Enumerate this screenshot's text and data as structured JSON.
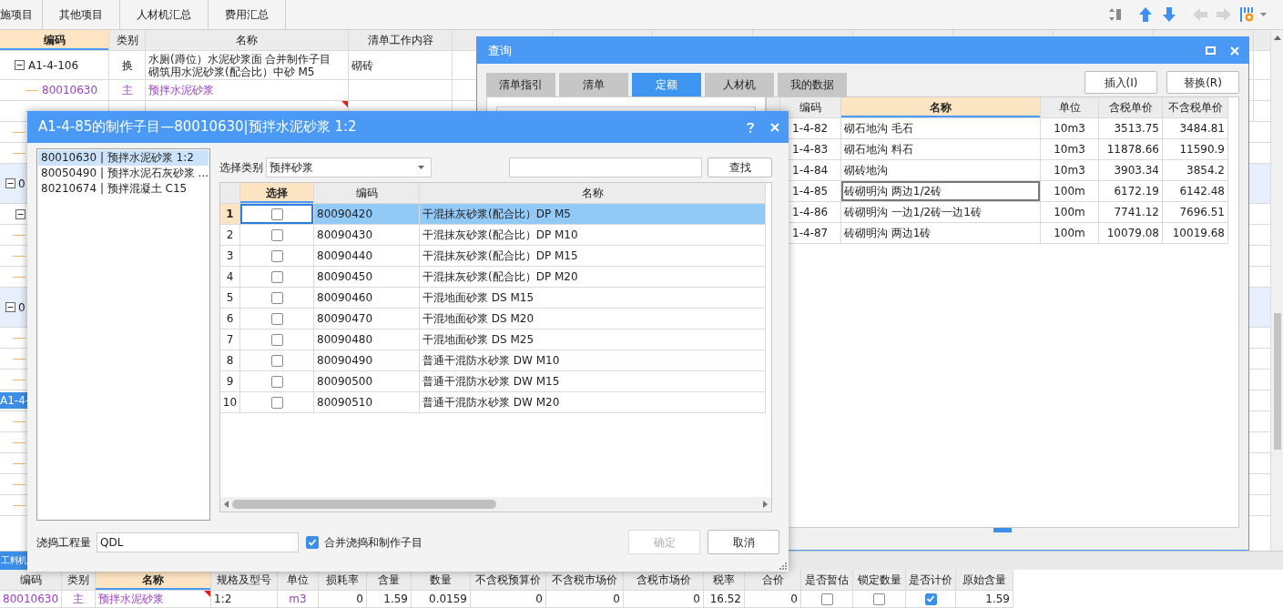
{
  "app_tabs": [
    {
      "label": "施项目"
    },
    {
      "label": "其他项目"
    },
    {
      "label": "人材机汇总"
    },
    {
      "label": "费用汇总"
    }
  ],
  "toolbar": [
    {
      "kind": "sort",
      "disabled": false
    },
    {
      "kind": "up",
      "disabled": false
    },
    {
      "kind": "down",
      "disabled": false
    },
    {
      "kind": "left",
      "disabled": true
    },
    {
      "kind": "right",
      "disabled": true
    },
    {
      "kind": "settings",
      "disabled": false
    }
  ],
  "main_grid": {
    "columns": [
      {
        "label": "编码",
        "selected": true
      },
      {
        "label": "类别",
        "selected": false
      },
      {
        "label": "名称",
        "selected": false
      },
      {
        "label": "清单工作内容",
        "selected": false
      }
    ],
    "rows": [
      {
        "kind": "quota",
        "expanded": true,
        "code": "A1-4-106",
        "type": "换",
        "name_lines": [
          "水厕(蹲位）水泥砂浆面  合并制作子目",
          "砌筑用水泥砂浆(配合比）中砂 M5"
        ],
        "content": "砌砖"
      },
      {
        "kind": "material",
        "code": "80010630",
        "type": "主",
        "name_lines": [
          "预拌水泥砂浆"
        ]
      },
      {
        "kind": "covered",
        "flagged": true
      }
    ],
    "stubs": [
      {
        "kind": "leaf"
      },
      {
        "kind": "leaf"
      },
      {
        "kind": "group",
        "code": "0",
        "expanded": true
      },
      {
        "kind": "node",
        "expanded": true
      },
      {
        "kind": "leaf"
      },
      {
        "kind": "leaf"
      },
      {
        "kind": "leaf"
      },
      {
        "kind": "group",
        "code": "0",
        "expanded": true
      },
      {
        "kind": "leaf"
      },
      {
        "kind": "leaf"
      },
      {
        "kind": "leaf"
      },
      {
        "kind": "quota",
        "code": "A1-4-",
        "selected": true
      },
      {
        "kind": "leaf"
      },
      {
        "kind": "leaf"
      },
      {
        "kind": "leaf"
      },
      {
        "kind": "leaf"
      },
      {
        "kind": "leaf"
      }
    ]
  },
  "bottom_panel": {
    "tab": "工料机",
    "columns": [
      {
        "label": "编码",
        "selected": false
      },
      {
        "label": "类别",
        "selected": false
      },
      {
        "label": "名称",
        "selected": true
      },
      {
        "label": "规格及型号",
        "selected": false
      },
      {
        "label": "单位",
        "selected": false
      },
      {
        "label": "损耗率",
        "selected": false
      },
      {
        "label": "含量",
        "selected": false
      },
      {
        "label": "数量",
        "selected": false
      },
      {
        "label": "不含税预算价",
        "selected": false
      },
      {
        "label": "不含税市场价",
        "selected": false
      },
      {
        "label": "含税市场价",
        "selected": false
      },
      {
        "label": "税率",
        "selected": false
      },
      {
        "label": "合价",
        "selected": false
      },
      {
        "label": "是否暂估",
        "selected": false
      },
      {
        "label": "锁定数量",
        "selected": false
      },
      {
        "label": "是否计价",
        "selected": false
      },
      {
        "label": "原始含量",
        "selected": false
      }
    ],
    "rows": [
      {
        "flagged": true,
        "cells": [
          {
            "kind": "text",
            "text": "80010630"
          },
          {
            "kind": "text",
            "text": "主"
          },
          {
            "kind": "text",
            "text": "预拌水泥砂浆"
          },
          {
            "kind": "text",
            "text": "1:2"
          },
          {
            "kind": "text",
            "text": "m3"
          },
          {
            "kind": "text",
            "text": "0"
          },
          {
            "kind": "text",
            "text": "1.59"
          },
          {
            "kind": "text",
            "text": "0.0159"
          },
          {
            "kind": "text",
            "text": "0"
          },
          {
            "kind": "text",
            "text": "0"
          },
          {
            "kind": "text",
            "text": "0"
          },
          {
            "kind": "text",
            "text": "16.52"
          },
          {
            "kind": "text",
            "text": "0"
          },
          {
            "kind": "check",
            "checked": false
          },
          {
            "kind": "check",
            "checked": false
          },
          {
            "kind": "check",
            "checked": true
          },
          {
            "kind": "text",
            "text": "1.59"
          }
        ]
      }
    ]
  },
  "query_window": {
    "title": "查询",
    "tabs": [
      {
        "label": "清单指引",
        "selected": false
      },
      {
        "label": "清单",
        "selected": false
      },
      {
        "label": "定额",
        "selected": true
      },
      {
        "label": "人材机",
        "selected": false
      },
      {
        "label": "我的数据",
        "selected": false
      }
    ],
    "buttons": [
      "插入(I)",
      "替换(R)"
    ],
    "table": {
      "columns": [
        {
          "label": "编码",
          "selected": false
        },
        {
          "label": "名称",
          "selected": true
        },
        {
          "label": "单位",
          "selected": false
        },
        {
          "label": "含税单价",
          "selected": false
        },
        {
          "label": "不含税单价",
          "selected": false
        }
      ],
      "rows": [
        {
          "code": "1-4-82",
          "name": "砌石地沟 毛石",
          "unit": "10m3",
          "price_tax": "3513.75",
          "price_notax": "3484.81",
          "focused": false
        },
        {
          "code": "1-4-83",
          "name": "砌石地沟 料石",
          "unit": "10m3",
          "price_tax": "11878.66",
          "price_notax": "11590.9",
          "focused": false
        },
        {
          "code": "1-4-84",
          "name": "砌砖地沟",
          "unit": "10m3",
          "price_tax": "3903.34",
          "price_notax": "3854.2",
          "focused": false
        },
        {
          "code": "1-4-85",
          "name": "砖砌明沟 两边1/2砖",
          "unit": "100m",
          "price_tax": "6172.19",
          "price_notax": "6142.48",
          "focused": true
        },
        {
          "code": "1-4-86",
          "name": "砖砌明沟 一边1/2砖一边1砖",
          "unit": "100m",
          "price_tax": "7741.12",
          "price_notax": "7696.51",
          "focused": false
        },
        {
          "code": "1-4-87",
          "name": "砖砌明沟 两边1砖",
          "unit": "100m",
          "price_tax": "10079.08",
          "price_notax": "10019.68",
          "focused": false
        }
      ]
    }
  },
  "dialog": {
    "title": "A1-4-85的制作子目—80010630|预拌水泥砂浆 1:2",
    "list": [
      {
        "text": "80010630 | 预拌水泥砂浆 1:2",
        "selected": true
      },
      {
        "text": "80050490 | 预拌水泥石灰砂浆 ...",
        "selected": false
      },
      {
        "text": "80210674 | 预拌混凝土 C15",
        "selected": false
      }
    ],
    "category_label": "选择类别",
    "category": "预拌砂浆",
    "search_button": "查找",
    "table": {
      "columns": [
        {
          "label": "选择",
          "selected": true
        },
        {
          "label": "编码",
          "selected": false
        },
        {
          "label": "名称",
          "selected": false
        }
      ],
      "rows": [
        {
          "index": "1",
          "checked": false,
          "code": "80090420",
          "name": "干混抹灰砂浆(配合比）DP M5",
          "selected": true
        },
        {
          "index": "2",
          "checked": false,
          "code": "80090430",
          "name": "干混抹灰砂浆(配合比）DP M10",
          "selected": false
        },
        {
          "index": "3",
          "checked": false,
          "code": "80090440",
          "name": "干混抹灰砂浆(配合比）DP M15",
          "selected": false
        },
        {
          "index": "4",
          "checked": false,
          "code": "80090450",
          "name": "干混抹灰砂浆(配合比）DP M20",
          "selected": false
        },
        {
          "index": "5",
          "checked": false,
          "code": "80090460",
          "name": "干混地面砂浆 DS M15",
          "selected": false
        },
        {
          "index": "6",
          "checked": false,
          "code": "80090470",
          "name": "干混地面砂浆 DS M20",
          "selected": false
        },
        {
          "index": "7",
          "checked": false,
          "code": "80090480",
          "name": "干混地面砂浆 DS M25",
          "selected": false
        },
        {
          "index": "8",
          "checked": false,
          "code": "80090490",
          "name": "普通干混防水砂浆 DW M10",
          "selected": false
        },
        {
          "index": "9",
          "checked": false,
          "code": "80090500",
          "name": "普通干混防水砂浆 DW M15",
          "selected": false
        },
        {
          "index": "10",
          "checked": false,
          "code": "80090510",
          "name": "普通干混防水砂浆 DW M20",
          "selected": false
        }
      ]
    },
    "quantity_label": "浇捣工程量",
    "quantity": "QDL",
    "merge": {
      "label": "合并浇捣和制作子目",
      "checked": true
    },
    "buttons": [
      {
        "label": "确定",
        "disabled": true
      },
      {
        "label": "取消",
        "disabled": false
      }
    ]
  }
}
